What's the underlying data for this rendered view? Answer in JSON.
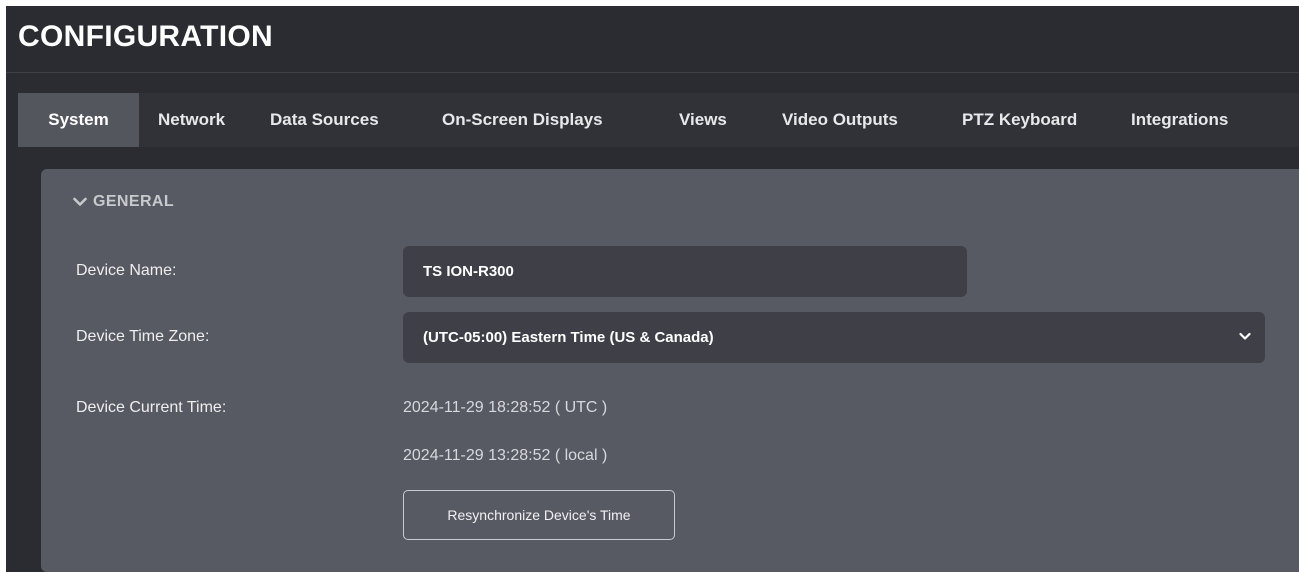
{
  "header": {
    "title": "CONFIGURATION"
  },
  "tabs": [
    {
      "label": "System",
      "active": true
    },
    {
      "label": "Network",
      "active": false
    },
    {
      "label": "Data Sources",
      "active": false
    },
    {
      "label": "On-Screen Displays",
      "active": false
    },
    {
      "label": "Views",
      "active": false
    },
    {
      "label": "Video Outputs",
      "active": false
    },
    {
      "label": "PTZ Keyboard",
      "active": false
    },
    {
      "label": "Integrations",
      "active": false
    }
  ],
  "general": {
    "section_title": "GENERAL",
    "section_icon": "chevron-down-icon",
    "device_name": {
      "label": "Device Name:",
      "value": "TS ION-R300"
    },
    "time_zone": {
      "label": "Device Time Zone:",
      "selected": "(UTC-05:00) Eastern Time (US & Canada)"
    },
    "current_time": {
      "label": "Device Current Time:",
      "utc": "2024-11-29 18:28:52   ( UTC )",
      "local": "2024-11-29 13:28:52   ( local )"
    },
    "resync_button": "Resynchronize Device's Time"
  },
  "colors": {
    "background": "#2b2c31",
    "tab_bar": "#313238",
    "tab_active": "#54565e",
    "panel": "#585a63",
    "field": "#3f4047"
  }
}
